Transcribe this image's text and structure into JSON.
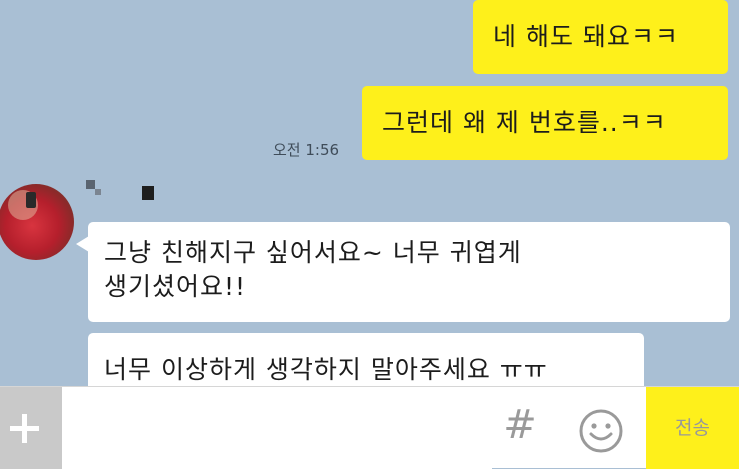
{
  "messages": {
    "out1": "네 해도 돼요ㅋㅋ",
    "out2": "그런데 왜 제 번호를..ㅋㅋ",
    "timestamp": "오전 1:56",
    "in1_line1": "그냥 친해지구 싶어서요~ 너무 귀엽게",
    "in1_line2": "생기셨어요!!",
    "in2": "너무 이상하게 생각하지 말아주세요 ㅠㅠ"
  },
  "input": {
    "hash_symbol": "#",
    "send_label": "전송"
  },
  "colors": {
    "background": "#a9bfd4",
    "outgoing_bubble": "#fef01b",
    "incoming_bubble": "#ffffff",
    "send_button": "#fef01b"
  },
  "icons": {
    "plus": "plus-icon",
    "hash": "hash-icon",
    "emoji": "smiley-icon"
  }
}
